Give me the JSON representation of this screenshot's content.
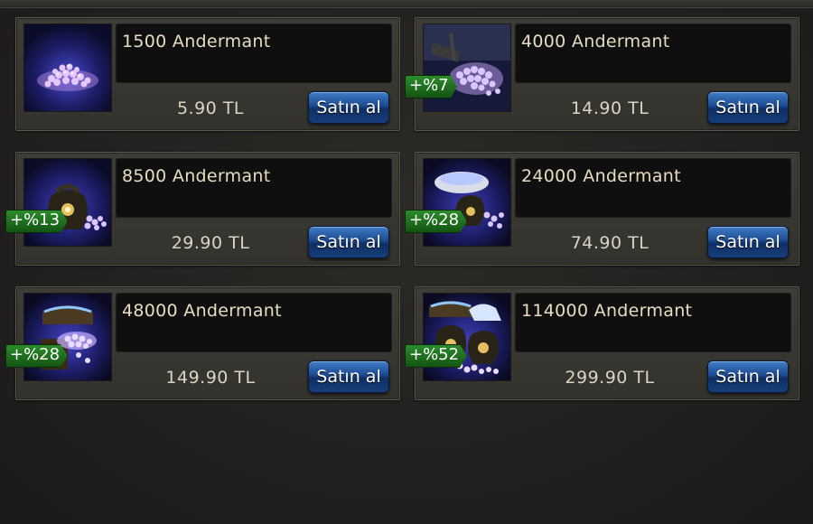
{
  "colors": {
    "background": "#232120",
    "card": "#3a3832",
    "name_box": "#0f0f0f",
    "name_text": "#e8dcc0",
    "price_text": "#d9d4c8",
    "buy_button": "#1d4a8f",
    "bonus_badge": "#1f7a1f"
  },
  "currency": "Andermant",
  "packages": [
    {
      "name": "1500 Andermant",
      "price": "5.90 TL",
      "buy_label": "Satın al",
      "bonus": "",
      "image_icon": "gem-pile-icon"
    },
    {
      "name": "4000 Andermant",
      "price": "14.90 TL",
      "buy_label": "Satın al",
      "bonus": "+%7",
      "image_icon": "gem-cart-icon"
    },
    {
      "name": "8500 Andermant",
      "price": "29.90 TL",
      "buy_label": "Satın al",
      "bonus": "+%13",
      "image_icon": "gem-sack-icon"
    },
    {
      "name": "24000 Andermant",
      "price": "74.90 TL",
      "buy_label": "Satın al",
      "bonus": "+%28",
      "image_icon": "gem-bowl-icon"
    },
    {
      "name": "48000 Andermant",
      "price": "149.90 TL",
      "buy_label": "Satın al",
      "bonus": "+%28",
      "image_icon": "gem-chest-icon"
    },
    {
      "name": "114000 Andermant",
      "price": "299.90 TL",
      "buy_label": "Satın al",
      "bonus": "+%52",
      "image_icon": "gem-treasure-icon"
    }
  ]
}
